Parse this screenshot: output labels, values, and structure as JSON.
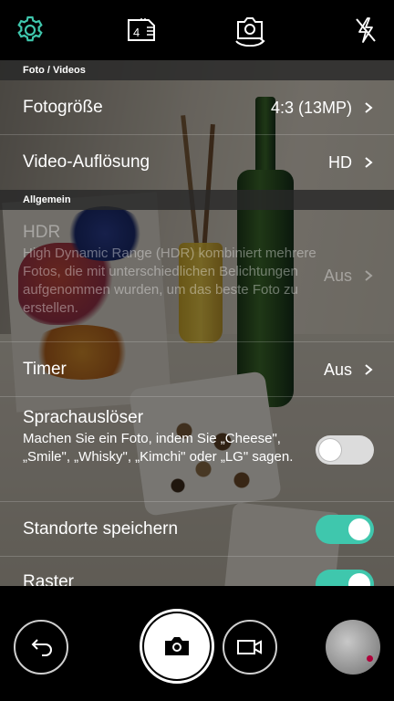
{
  "topbar": {
    "icons": [
      "gear-icon",
      "storage-card-icon",
      "switch-camera-icon",
      "flash-off-icon"
    ],
    "accent": "#3fc7ad",
    "storage_badge": "4"
  },
  "sections": {
    "photo_video": "Foto / Videos",
    "general": "Allgemein"
  },
  "settings": {
    "photo_size": {
      "label": "Fotogröße",
      "value": "4:3 (13MP)"
    },
    "video_resolution": {
      "label": "Video-Auflösung",
      "value": "HD"
    },
    "hdr": {
      "label": "HDR",
      "description": "High Dynamic Range (HDR) kombiniert mehrere Fotos, die mit unterschiedlichen Belichtungen aufgenommen wurden, um das beste Foto zu erstellen.",
      "value": "Aus",
      "disabled": true
    },
    "timer": {
      "label": "Timer",
      "value": "Aus"
    },
    "voice_shutter": {
      "label": "Sprachauslöser",
      "description": "Machen Sie ein Foto, indem Sie „Cheese\", „Smile\", „Whisky\", „Kimchi\" oder „LG\" sagen.",
      "enabled": false
    },
    "save_location": {
      "label": "Standorte speichern",
      "enabled": true
    },
    "grid": {
      "label": "Raster",
      "enabled": true
    }
  },
  "bottombar": {
    "icons": [
      "back-arrow-icon",
      "camera-shutter-icon",
      "video-camera-icon",
      "gallery-thumbnail"
    ]
  },
  "colors": {
    "toggle_on": "#3fc7ad",
    "toggle_off": "#dcdcdc"
  }
}
